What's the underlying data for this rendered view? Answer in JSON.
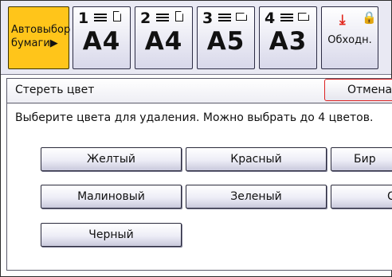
{
  "paper_trays": {
    "auto_select": {
      "line1": "Автовыбор",
      "line2": "бумаги",
      "arrow": "▶"
    },
    "trays": [
      {
        "number": "1",
        "size": "A4",
        "orientation": "portrait"
      },
      {
        "number": "2",
        "size": "A4",
        "orientation": "portrait"
      },
      {
        "number": "3",
        "size": "A5",
        "orientation": "landscape"
      },
      {
        "number": "4",
        "size": "A3",
        "orientation": "landscape"
      }
    ],
    "bypass": {
      "label": "Обходн.",
      "icons": [
        "download-arrow-icon",
        "lock-icon"
      ]
    }
  },
  "dialog": {
    "title": "Стереть цвет",
    "cancel_label": "Отмена",
    "instruction": "Выберите цвета для удаления. Можно выбрать до 4 цветов.",
    "colors": {
      "yellow": "Желтый",
      "red": "Красный",
      "turquoise_partial": "Бир",
      "magenta": "Малиновый",
      "green": "Зеленый",
      "third_row2_partial": "С",
      "black": "Черный"
    }
  },
  "colors": {
    "accent": "#ffc51a",
    "cancel_border": "#dd2222",
    "icon_red": "#e2261c"
  }
}
